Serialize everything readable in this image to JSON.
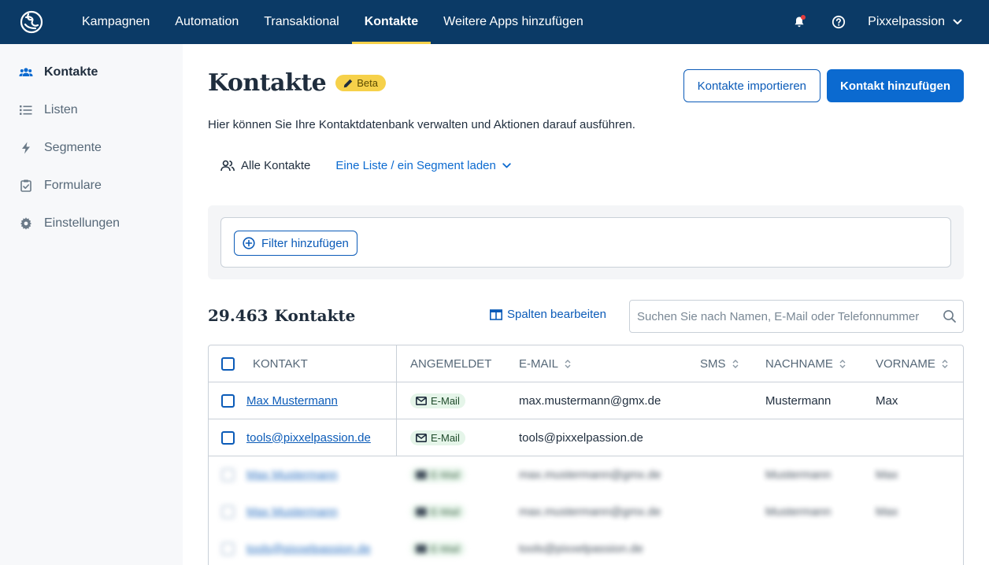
{
  "topnav": {
    "items": [
      {
        "label": "Kampagnen",
        "active": false
      },
      {
        "label": "Automation",
        "active": false
      },
      {
        "label": "Transaktional",
        "active": false
      },
      {
        "label": "Kontakte",
        "active": true
      },
      {
        "label": "Weitere Apps hinzufügen",
        "active": false
      }
    ],
    "account": "Pixxelpassion",
    "icons": [
      "logo-icon",
      "bell-icon",
      "help-icon",
      "chevron-down-icon"
    ],
    "accent": "#f6d14a",
    "background": "#0b3a66"
  },
  "sidebar": {
    "items": [
      {
        "label": "Kontakte",
        "icon": "users-icon",
        "active": true
      },
      {
        "label": "Listen",
        "icon": "list-icon",
        "active": false
      },
      {
        "label": "Segmente",
        "icon": "bolt-icon",
        "active": false
      },
      {
        "label": "Formulare",
        "icon": "clipboard-icon",
        "active": false
      },
      {
        "label": "Einstellungen",
        "icon": "gear-icon",
        "active": false
      }
    ]
  },
  "page": {
    "title": "Kontakte",
    "badge": "Beta",
    "subtitle": "Hier können Sie Ihre Kontaktdatenbank verwalten und Aktionen darauf ausführen.",
    "import_label": "Kontakte importieren",
    "add_label": "Kontakt hinzufügen",
    "primary_color": "#0b6ad0"
  },
  "tabs": {
    "all": "Alle Kontakte",
    "load": "Eine Liste / ein Segment laden"
  },
  "filter": {
    "add_label": "Filter hinzufügen"
  },
  "summary": {
    "count": "29.463",
    "count_label": "Kontakte",
    "edit_columns": "Spalten bearbeiten",
    "search_placeholder": "Suchen Sie nach Namen, E-Mail oder Telefonnummer"
  },
  "table": {
    "headers": {
      "contact": "KONTAKT",
      "subscribed": "ANGEMELDET",
      "email": "E-MAIL",
      "sms": "SMS",
      "lastname": "NACHNAME",
      "firstname": "VORNAME"
    },
    "rows": [
      {
        "contact": "Max Mustermann",
        "subscribed": "E-Mail",
        "email": "max.mustermann@gmx.de",
        "sms": "",
        "lastname": "Mustermann",
        "firstname": "Max"
      },
      {
        "contact": "tools@pixxelpassion.de",
        "subscribed": "E-Mail",
        "email": "tools@pixxelpassion.de",
        "sms": "",
        "lastname": "",
        "firstname": ""
      },
      {
        "contact": "Max Mustermann",
        "subscribed": "E-Mail",
        "email": "max.mustermann@gmx.de",
        "sms": "",
        "lastname": "Mustermann",
        "firstname": "Max"
      },
      {
        "contact": "Max Mustermann",
        "subscribed": "E-Mail",
        "email": "max.mustermann@gmx.de",
        "sms": "",
        "lastname": "Mustermann",
        "firstname": "Max"
      },
      {
        "contact": "tools@pixxelpassion.de",
        "subscribed": "E-Mail",
        "email": "tools@pixxelpassion.de",
        "sms": "",
        "lastname": "",
        "firstname": ""
      }
    ]
  }
}
